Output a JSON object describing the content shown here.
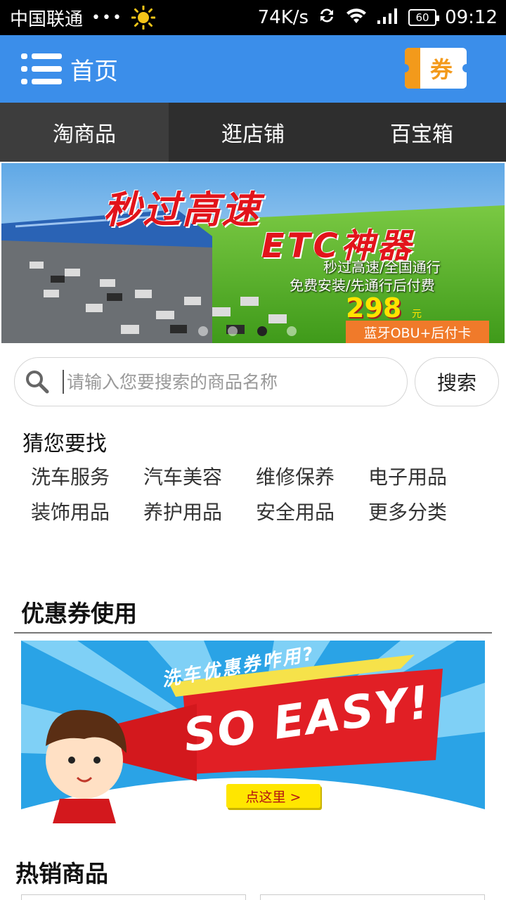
{
  "status_bar": {
    "carrier": "中国联通",
    "dots": "•••",
    "speed": "74K/s",
    "battery": "60",
    "time": "09:12"
  },
  "header": {
    "menu_icon": "list-menu-icon",
    "title": "首页",
    "coupon_label": "券"
  },
  "tabs": [
    {
      "label": "淘商品",
      "active": true
    },
    {
      "label": "逛店铺",
      "active": false
    },
    {
      "label": "百宝箱",
      "active": false
    }
  ],
  "banner": {
    "headline": "秒过高速",
    "subheadline": "ETC神器",
    "line1": "秒过高速/全国通行",
    "line2": "免费安装/先通行后付费",
    "price": "298",
    "unit": "元",
    "tag": "蓝牙OBU+后付卡",
    "slide_count": 4,
    "active_slide": 3
  },
  "search": {
    "placeholder": "请输入您要搜索的商品名称",
    "button": "搜索"
  },
  "guess": {
    "title": "猜您要找",
    "items": [
      "洗车服务",
      "汽车美容",
      "维修保养",
      "电子用品",
      "装饰用品",
      "养护用品",
      "安全用品",
      "更多分类"
    ]
  },
  "coupon_section": {
    "title": "优惠券使用",
    "promo_line": "洗车优惠券咋用?",
    "promo_big": "SO EASY!",
    "promo_button": "点这里 >"
  },
  "hot_section": {
    "title": "热销商品"
  },
  "colors": {
    "header_blue": "#3b8eea",
    "tab_bg": "#2e2e2e",
    "coupon_orange": "#f39a1b"
  }
}
